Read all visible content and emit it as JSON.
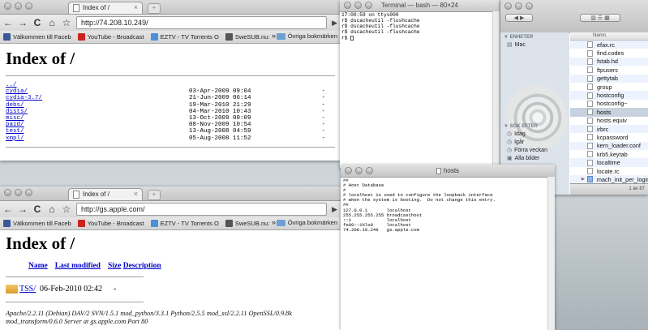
{
  "browser1": {
    "tab_title": "Index of /",
    "url": "http://74.208.10.249/",
    "bookmarks": [
      "Välkommen till Faceb",
      "YouTube - Broadcast",
      "EZTV - TV Torrents O",
      "SweSUB.nu:"
    ],
    "other_bookmarks": "Övriga bokmärken",
    "heading": "Index of /",
    "entries": [
      {
        "name": "../",
        "date": "",
        "size": ""
      },
      {
        "name": "cydia/",
        "date": "03-Apr-2009 09:04",
        "size": "-"
      },
      {
        "name": "cydia-3.7/",
        "date": "21-Jun-2009 06:14",
        "size": "-"
      },
      {
        "name": "debs/",
        "date": "19-Mar-2010 21:29",
        "size": "-"
      },
      {
        "name": "dists/",
        "date": "04-Mar-2010 10:43",
        "size": "-"
      },
      {
        "name": "misc/",
        "date": "13-Oct-2009 00:09",
        "size": "-"
      },
      {
        "name": "paid/",
        "date": "08-Nov-2009 10:54",
        "size": "-"
      },
      {
        "name": "test/",
        "date": "13-Aug-2008 04:59",
        "size": "-"
      },
      {
        "name": "xmpl/",
        "date": "05-Aug-2008 11:52",
        "size": "-"
      }
    ]
  },
  "browser2": {
    "tab_title": "Index of /",
    "url": "http://gs.apple.com/",
    "bookmarks": [
      "Välkommen till Faceb",
      "YouTube - Broadcast",
      "EZTV - TV Torrents O",
      "SweSUB.nu:"
    ],
    "other_bookmarks": "Övriga bokmärken",
    "heading": "Index of /",
    "columns": [
      "Name",
      "Last modified",
      "Size",
      "Description"
    ],
    "dir_name": "TSS/",
    "dir_date": "06-Feb-2010 02:42",
    "dir_size": "-",
    "server_line1": "Apache/2.2.11 (Debian) DAV/2 SVN/1.5.1 mod_python/3.3.1 Python/2.5.5 mod_ssl/2.2.11 OpenSSL/0.9.8k",
    "server_line2": "mod_transform/0.6.0 Server at gs.apple.com Port 80"
  },
  "terminal": {
    "title": "Terminal — bash — 80×24",
    "lines": [
      "17:00:59 on ttys000",
      "r$ dscacheutil -flushcache",
      "r$ dscacheutil -flushcache",
      "r$ dscacheutil -flushcache",
      "r$ "
    ]
  },
  "finder": {
    "section_devices": "ENHETER",
    "device_mac": "Mac",
    "section_search": "SÖK EFTER",
    "search_items": [
      "Idag",
      "Igår",
      "Förra veckan",
      "Alla bilder"
    ],
    "column_name": "Namn",
    "files": [
      "efax.rc",
      "find.codes",
      "fstab.hd",
      "ftpusers",
      "gettytab",
      "group",
      "hostconfig",
      "hostconfig~",
      "hosts",
      "hosts.equiv",
      "irbrc",
      "kcpassword",
      "kern_loader.conf",
      "krb5.keytab",
      "localtime",
      "locate.rc",
      "mach_init_per_login",
      "mach_init_per_user"
    ],
    "selected_file": "hosts",
    "status": "1 av 87"
  },
  "hosts_editor": {
    "title": "hosts",
    "lines": [
      "##",
      "# Host Database",
      "#",
      "# localhost is used to configure the loopback interface",
      "# when the system is booting.  Do not change this entry.",
      "##",
      "127.0.0.1       localhost",
      "255.255.255.255 broadcasthost",
      "::1             localhost",
      "fe80::1%lo0     localhost",
      "74.208.10.249   gs.apple.com"
    ]
  },
  "colors": {
    "link": "#0000cc",
    "selection": "#c8d2de",
    "row_stripe": "#edf3fe"
  }
}
